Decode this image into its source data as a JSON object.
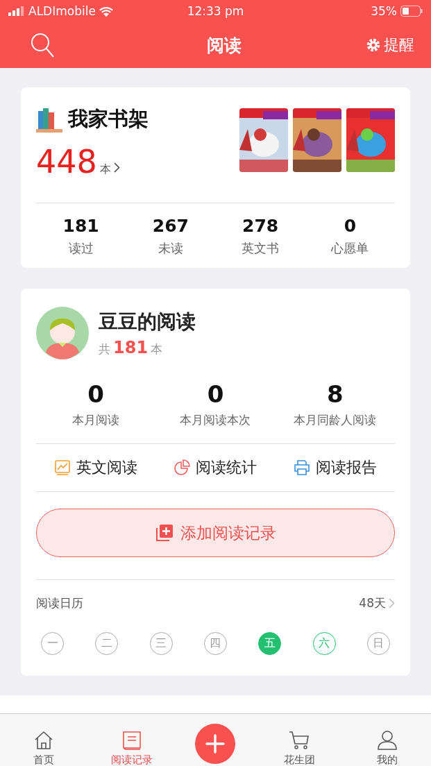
{
  "status_bar": {
    "carrier": "ALDImobile",
    "time": "12:33 pm",
    "battery": "35%"
  },
  "nav": {
    "title": "阅读",
    "reminder": "提醒"
  },
  "bookshelf": {
    "title": "我家书架",
    "count": "448",
    "unit": "本",
    "stats": [
      {
        "value": "181",
        "label": "读过"
      },
      {
        "value": "267",
        "label": "未读"
      },
      {
        "value": "278",
        "label": "英文书"
      },
      {
        "value": "0",
        "label": "心愿单"
      }
    ]
  },
  "reader": {
    "name": "豆豆的阅读",
    "total_prefix": "共",
    "total": "181",
    "total_unit": "本",
    "stats": [
      {
        "value": "0",
        "label": "本月阅读"
      },
      {
        "value": "0",
        "label": "本月阅读本次"
      },
      {
        "value": "8",
        "label": "本月同龄人阅读"
      }
    ],
    "links": [
      {
        "kind": "chart",
        "label": "英文阅读"
      },
      {
        "kind": "pie",
        "label": "阅读统计"
      },
      {
        "kind": "printer",
        "label": "阅读报告"
      }
    ],
    "add_button": "添加阅读记录",
    "calendar": {
      "title": "阅读日历",
      "days_count": "48天",
      "days": [
        {
          "label": "一",
          "kind": "plain"
        },
        {
          "label": "二",
          "kind": "plain"
        },
        {
          "label": "三",
          "kind": "plain"
        },
        {
          "label": "四",
          "kind": "plain"
        },
        {
          "label": "五",
          "kind": "read"
        },
        {
          "label": "六",
          "kind": "today"
        },
        {
          "label": "日",
          "kind": "plain"
        }
      ]
    }
  },
  "tab_bar": [
    {
      "kind": "home",
      "label": "首页",
      "selected": false
    },
    {
      "kind": "book",
      "label": "阅读记录",
      "selected": true
    },
    {
      "kind": "add"
    },
    {
      "kind": "cart",
      "label": "花生团",
      "selected": false
    },
    {
      "kind": "person",
      "label": "我的",
      "selected": false
    }
  ]
}
